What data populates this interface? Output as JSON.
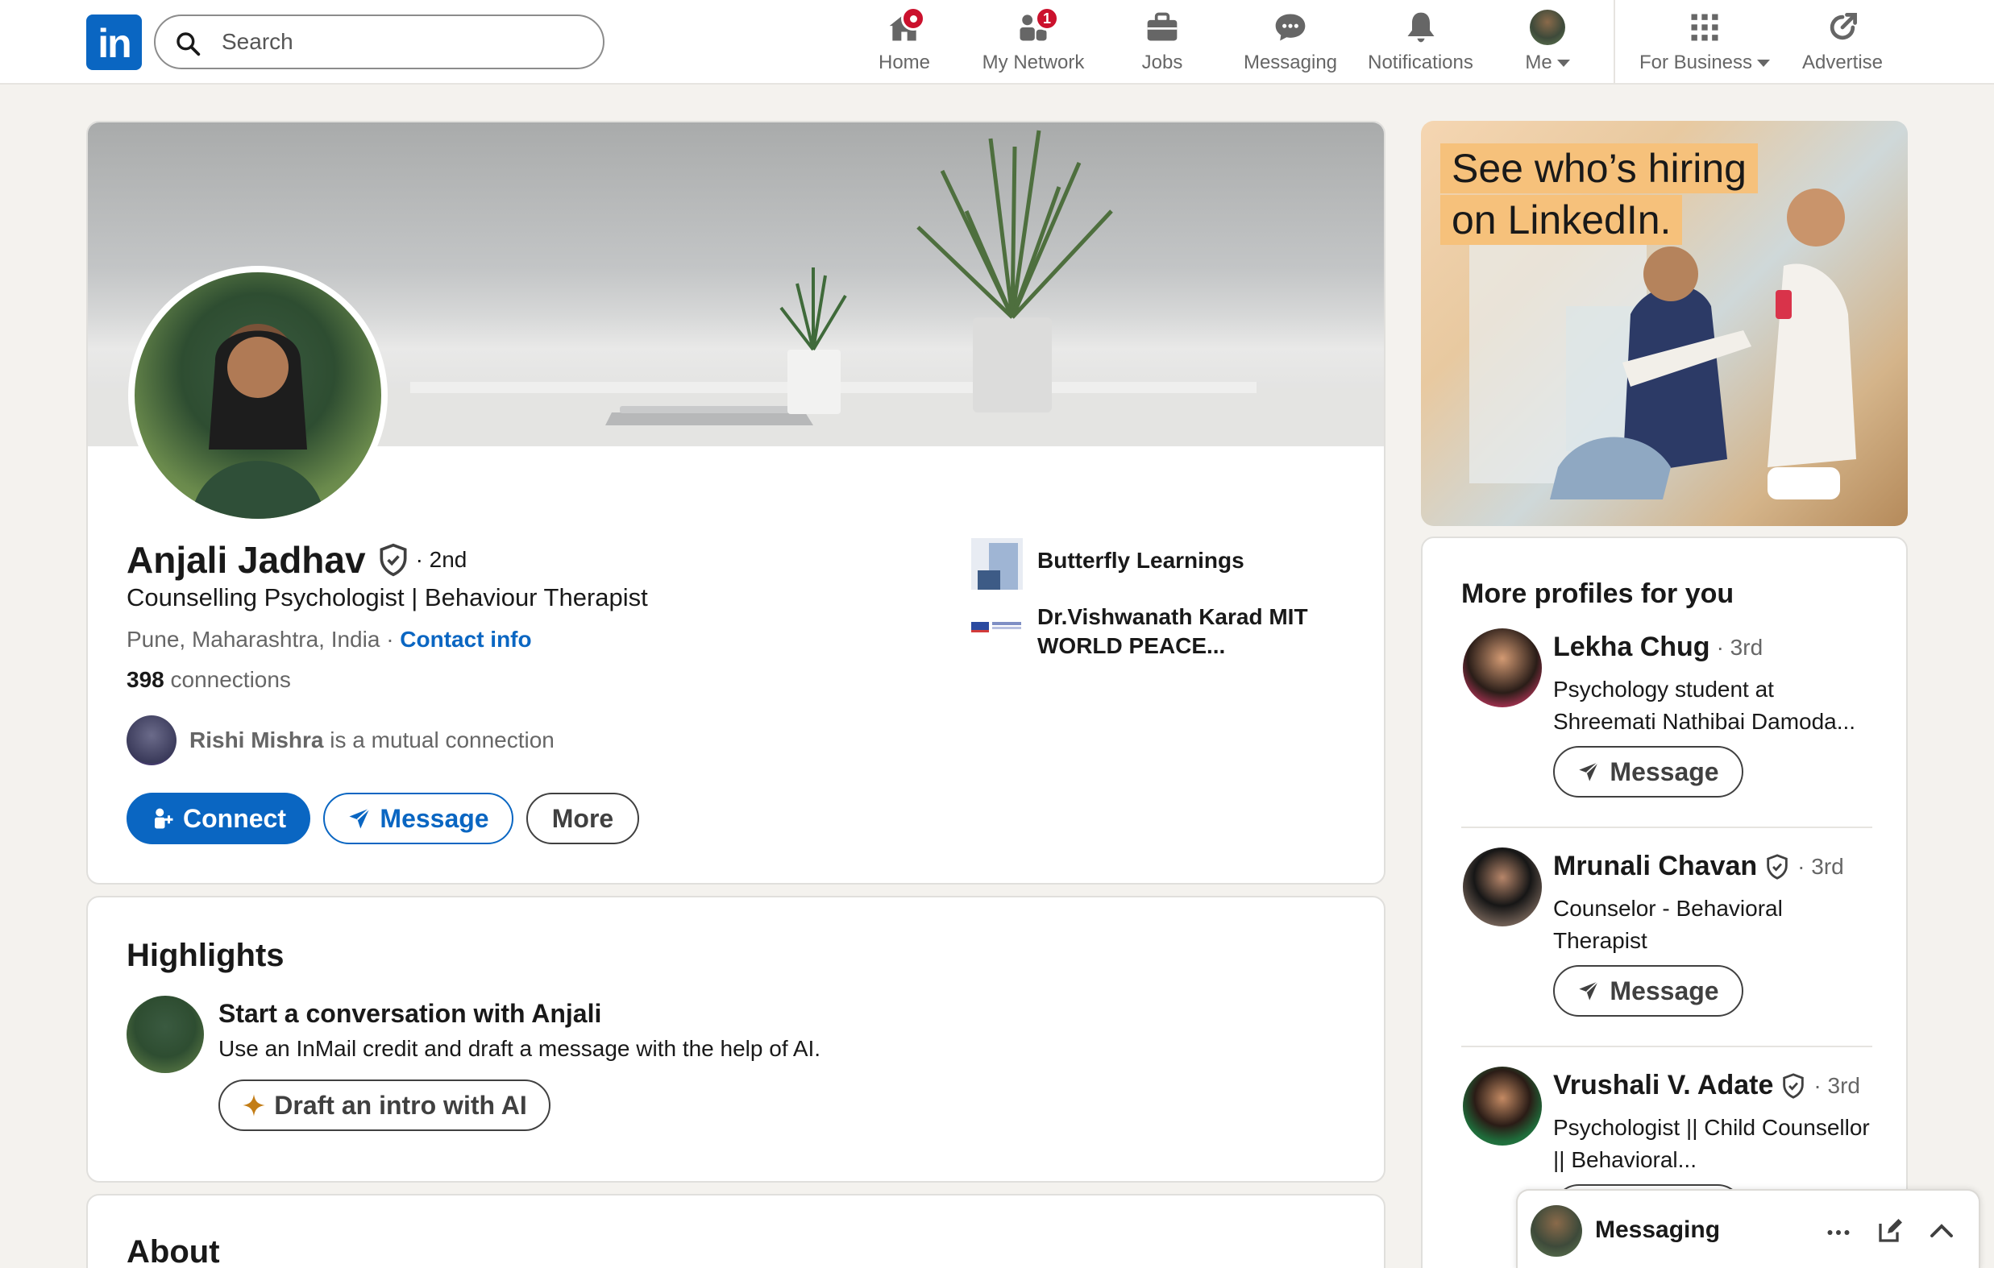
{
  "nav": {
    "logo_text": "in",
    "search_placeholder": "Search",
    "items": [
      {
        "label": "Home",
        "icon": "home-icon",
        "badge": ""
      },
      {
        "label": "My Network",
        "icon": "network-icon",
        "badge": "1"
      },
      {
        "label": "Jobs",
        "icon": "briefcase-icon",
        "badge": ""
      },
      {
        "label": "Messaging",
        "icon": "messaging-icon",
        "badge": ""
      },
      {
        "label": "Notifications",
        "icon": "bell-icon",
        "badge": ""
      },
      {
        "label": "Me",
        "icon": "avatar",
        "badge": ""
      },
      {
        "label": "For Business",
        "icon": "grid-icon",
        "badge": ""
      },
      {
        "label": "Advertise",
        "icon": "advertise-icon",
        "badge": ""
      }
    ]
  },
  "profile": {
    "name": "Anjali Jadhav",
    "degree": "· 2nd",
    "headline": "Counselling Psychologist | Behaviour Therapist",
    "location": "Pune, Maharashtra, India ·",
    "contact_info": "Contact info",
    "connections_count": "398",
    "connections_label": "connections",
    "mutual_name": "Rishi Mishra",
    "mutual_text": "is a mutual connection",
    "buttons": {
      "connect": "Connect",
      "message": "Message",
      "more": "More"
    },
    "companies": [
      {
        "name": "Butterfly Learnings"
      },
      {
        "name": "Dr.Vishwanath Karad MIT WORLD PEACE..."
      }
    ]
  },
  "highlights": {
    "title": "Highlights",
    "item_title": "Start a conversation with Anjali",
    "item_desc": "Use an InMail credit and draft a message with the help of AI.",
    "button": "Draft an intro with AI"
  },
  "about": {
    "title": "About"
  },
  "ad": {
    "line1": "See who’s hiring",
    "line2": "on LinkedIn."
  },
  "more_profiles": {
    "title": "More profiles for you",
    "button": "Message",
    "items": [
      {
        "name": "Lekha Chug",
        "degree": "· 3rd",
        "verified": false,
        "desc": "Psychology student at Shreemati Nathibai Damoda..."
      },
      {
        "name": "Mrunali Chavan",
        "degree": "· 3rd",
        "verified": true,
        "desc": "Counselor - Behavioral Therapist"
      },
      {
        "name": "Vrushali V. Adate",
        "degree": "· 3rd",
        "verified": true,
        "desc": "Psychologist || Child Counsellor || Behavioral..."
      }
    ]
  },
  "messaging_dock": {
    "title": "Messaging"
  },
  "colors": {
    "brand": "#0a66c2",
    "badge": "#cb112d",
    "background": "#f4f2ee"
  }
}
